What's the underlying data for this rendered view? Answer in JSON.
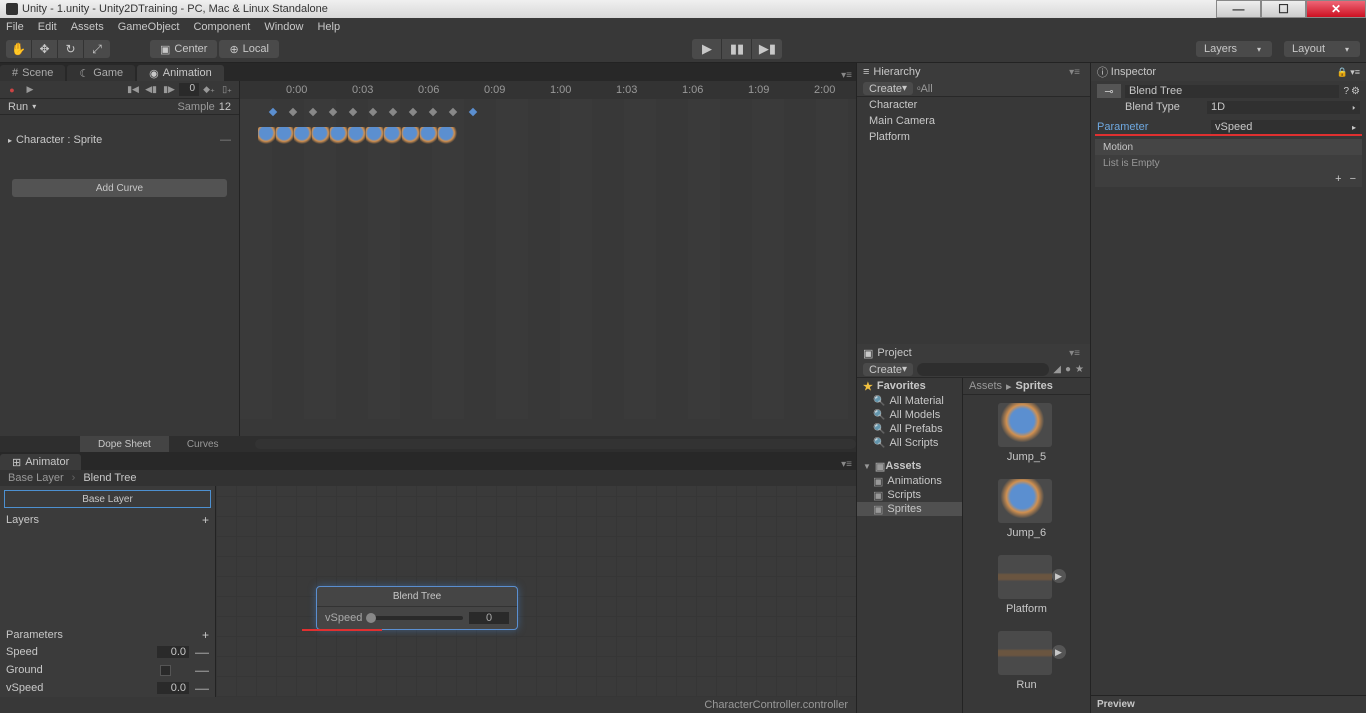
{
  "window": {
    "title": "Unity - 1.unity - Unity2DTraining - PC, Mac & Linux Standalone"
  },
  "menu": [
    "File",
    "Edit",
    "Assets",
    "GameObject",
    "Component",
    "Window",
    "Help"
  ],
  "toolbar": {
    "center": "Center",
    "local": "Local",
    "layers": "Layers",
    "layout": "Layout"
  },
  "scene_tab": "Scene",
  "game_tab": "Game",
  "animation_tab": "Animation",
  "anim": {
    "frame": "0",
    "clip": "Run",
    "sample_label": "Sample",
    "sample": "12",
    "property": "Character : Sprite",
    "add_curve": "Add Curve",
    "times": [
      "0:00",
      "0:03",
      "0:06",
      "0:09",
      "1:00",
      "1:03",
      "1:06",
      "1:09",
      "2:00"
    ],
    "dopesheet": "Dope Sheet",
    "curves": "Curves"
  },
  "animator": {
    "tab": "Animator",
    "crumb1": "Base Layer",
    "crumb2": "Blend Tree",
    "base_layer": "Base Layer",
    "layers": "Layers",
    "parameters": "Parameters",
    "params": [
      {
        "name": "Speed",
        "value": "0.0",
        "type": "float"
      },
      {
        "name": "Ground",
        "type": "bool"
      },
      {
        "name": "vSpeed",
        "value": "0.0",
        "type": "float"
      }
    ],
    "node_title": "Blend Tree",
    "node_param": "vSpeed",
    "node_val": "0",
    "status": "CharacterController.controller"
  },
  "hierarchy": {
    "title": "Hierarchy",
    "create": "Create",
    "all": "All",
    "items": [
      "Character",
      "Main Camera",
      "Platform"
    ]
  },
  "project": {
    "title": "Project",
    "create": "Create",
    "favorites": "Favorites",
    "fav_items": [
      "All Material",
      "All Models",
      "All Prefabs",
      "All Scripts"
    ],
    "assets": "Assets",
    "folders": [
      "Animations",
      "Scripts",
      "Sprites"
    ],
    "path1": "Assets",
    "path2": "Sprites",
    "items": [
      {
        "name": "Jump_5"
      },
      {
        "name": "Jump_6"
      },
      {
        "name": "Platform"
      },
      {
        "name": "Run"
      }
    ]
  },
  "inspector": {
    "title": "Inspector",
    "name": "Blend Tree",
    "blend_type_label": "Blend Type",
    "blend_type": "1D",
    "parameter_label": "Parameter",
    "parameter": "vSpeed",
    "motion": "Motion",
    "empty": "List is Empty",
    "preview": "Preview"
  }
}
